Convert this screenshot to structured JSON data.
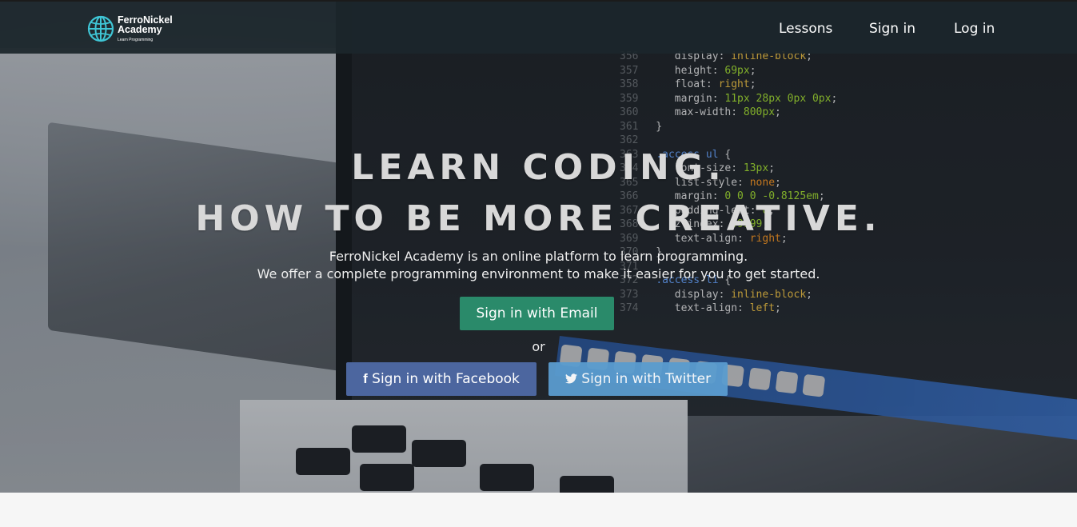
{
  "brand": {
    "name_line1": "FerroNickel",
    "name_line2": "Academy",
    "tagline": "Learn Programming"
  },
  "nav": {
    "items": [
      {
        "label": "Lessons"
      },
      {
        "label": "Sign in"
      },
      {
        "label": "Log in"
      }
    ]
  },
  "hero": {
    "headline_line1": "LEARN CODING.",
    "headline_line2": "HOW TO BE MORE CREATIVE.",
    "description_line1": "FerroNickel Academy is an online platform to learn programming.",
    "description_line2": "We offer a complete programming environment to make it easier for you to get started.",
    "email_button": "Sign in with Email",
    "or_text": "or",
    "facebook_button": "Sign in with Facebook",
    "twitter_button": "Sign in with Twitter"
  },
  "colors": {
    "navbar": "#1c262c",
    "email_button": "#2a8a6a",
    "facebook_button": "#4c669f",
    "twitter_button": "#5a9ccf"
  },
  "icons": [
    "globe-logo-icon",
    "facebook-icon",
    "twitter-icon"
  ]
}
